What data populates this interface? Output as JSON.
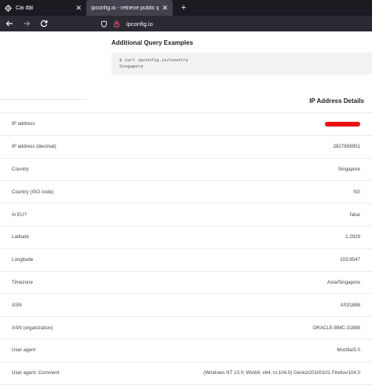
{
  "browser": {
    "tabs": [
      {
        "label": "Cài đặt",
        "icon": "gear-icon",
        "active": false
      },
      {
        "label": "ipconfig.io - retrieve public ip addre",
        "icon": "site-icon",
        "active": true
      }
    ],
    "close_glyph": "✕",
    "new_tab_glyph": "+",
    "url": "ipconfig.io"
  },
  "page": {
    "examples_title": "Additional Query Examples",
    "code_lines": [
      "$ curl ipconfig.io/country",
      "Singapore"
    ],
    "details_title": "IP Address Details",
    "rows": [
      {
        "label": "IP address",
        "value": "",
        "redacted": true
      },
      {
        "label": "IP address (decimal)",
        "value": "2827658951"
      },
      {
        "label": "Country",
        "value": "Singapore"
      },
      {
        "label": "Country (ISO code)",
        "value": "SG"
      },
      {
        "label": "In EU?",
        "value": "false"
      },
      {
        "label": "Latitude",
        "value": "1.2929"
      },
      {
        "label": "Longitude",
        "value": "103.8547"
      },
      {
        "label": "Timezone",
        "value": "Asia/Singapore"
      },
      {
        "label": "ASN",
        "value": "AS31898"
      },
      {
        "label": "ASN (organization)",
        "value": "ORACLE-BMC-31898"
      },
      {
        "label": "User agent",
        "value": "Mozilla/5.0"
      },
      {
        "label": "User agent: Comment",
        "value": "(Windows NT 10.0; Win64; x64; rv:104.0) Gecko/20100101 Firefox/104.0"
      }
    ]
  },
  "colors": {
    "tabbar": "#1c1b22",
    "active_tab": "#42414d",
    "navbar": "#2b2a33",
    "redaction": "#ee1111"
  }
}
